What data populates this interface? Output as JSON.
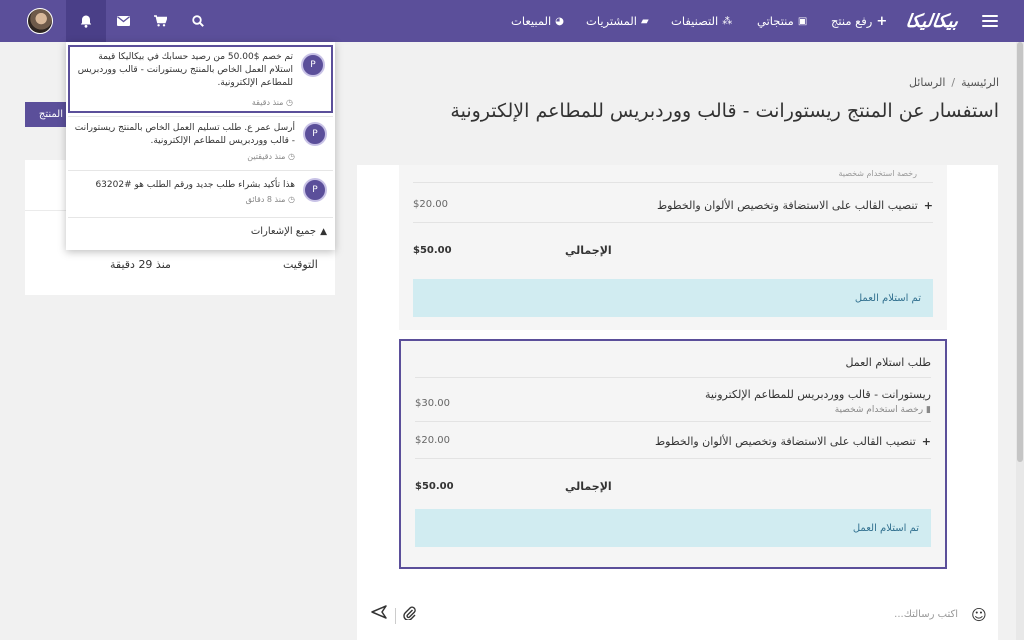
{
  "navbar": {
    "brand": "بيكاليكا",
    "links": {
      "upload": "رفع منتج",
      "my_products": "منتجاتي",
      "categories": "التصنيفات",
      "purchases": "المشتريات",
      "sales": "المبيعات"
    },
    "icons": [
      "search-icon",
      "cart-icon",
      "mail-icon",
      "bell-icon",
      "menu-icon",
      "avatar"
    ]
  },
  "breadcrumb": {
    "home": "الرئيسية",
    "messages": "الرسائل"
  },
  "page_title": "استفسار عن المنتج ريستورانت - قالب ووردبريس للمطاعم الإلكترونية",
  "sidebar": {
    "button_label": "المنتج",
    "time_label": "التوقيت",
    "time_value": "منذ 29 دقيقة"
  },
  "order_partial": {
    "item_license": "رخصة استخدام شخصية",
    "addon_desc": "تنصيب القالب على الاستضافة وتخصيص الألوان والخطوط",
    "addon_price": "$20.00",
    "total_label": "الإجمالي",
    "total_value": "$50.00",
    "status": "تم استلام العمل"
  },
  "order_request": {
    "heading": "طلب استلام العمل",
    "product_name": "ريستورانت - قالب ووردبريس للمطاعم الإلكترونية",
    "product_license": "رخصة استخدام شخصية",
    "product_price": "$30.00",
    "addon_desc": "تنصيب القالب على الاستضافة وتخصيص الألوان والخطوط",
    "addon_price": "$20.00",
    "total_label": "الإجمالي",
    "total_value": "$50.00",
    "status": "تم استلام العمل"
  },
  "composer": {
    "placeholder": "اكتب رسالتك..."
  },
  "notifications": {
    "items": [
      {
        "text": "تم خصم $50.00 من رصيد حسابك في بيكاليكا قيمة استلام العمل الخاص بالمنتج ريستورانت - قالب ووردبريس للمطاعم الإلكترونية.",
        "time": "منذ دقيقة"
      },
      {
        "text": "أرسل عمر ع. طلب تسليم العمل الخاص بالمنتج ريستورانت - قالب ووردبريس للمطاعم الإلكترونية.",
        "time": "منذ دقيقتين"
      },
      {
        "text": "هذا تأكيد بشراء طلب جديد ورقم الطلب هو #63202",
        "time": "منذ 8 دقائق"
      }
    ],
    "view_all": "جميع الإشعارات"
  },
  "colors": {
    "brand": "#5b4f9a",
    "status_bg": "#d1ecf1",
    "status_text": "#31708f"
  }
}
